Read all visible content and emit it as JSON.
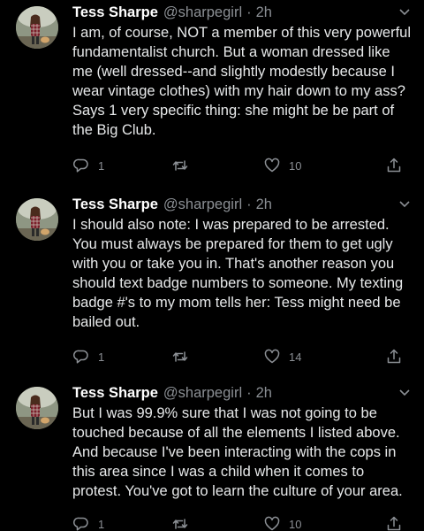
{
  "tweets": [
    {
      "name": "Tess Sharpe",
      "handle": "@sharpegirl",
      "separator": "·",
      "time": "2h",
      "lines": [
        "I am, of course, NOT a member of this very powerful",
        "fundamentalist church. But a woman dressed like",
        "me (well dressed--and slightly modestly because I",
        "wear vintage clothes) with my hair down to my ass?",
        "Says 1 very specific thing: she might be be part of",
        "the Big Club."
      ],
      "reply_count": "1",
      "retweet_count": "",
      "like_count": "10"
    },
    {
      "name": "Tess Sharpe",
      "handle": "@sharpegirl",
      "separator": "·",
      "time": "2h",
      "lines": [
        "I should also note: I was prepared to be arrested.",
        "You must always be prepared for them to get ugly",
        "with you or take you in. That's another reason you",
        "should text badge numbers to someone. My texting",
        "badge #'s to my mom tells her: Tess might need be",
        "bailed out."
      ],
      "reply_count": "1",
      "retweet_count": "",
      "like_count": "14"
    },
    {
      "name": "Tess Sharpe",
      "handle": "@sharpegirl",
      "separator": "·",
      "time": "2h",
      "lines": [
        "But I was 99.9% sure that I was not going to be",
        "touched because of all the elements I listed above.",
        "And because I've been interacting with the cops in",
        "this area since I was a child when it comes to",
        "protest. You've got to learn the culture of your area."
      ],
      "reply_count": "1",
      "retweet_count": "",
      "like_count": "10"
    }
  ],
  "icons": {
    "reply": "reply-icon",
    "retweet": "retweet-icon",
    "like": "heart-icon",
    "share": "share-icon",
    "caret": "chevron-down-icon"
  },
  "colors": {
    "background": "#000000",
    "name": "#ffffff",
    "secondary": "#8b8f94",
    "body": "#e7e9ea"
  }
}
